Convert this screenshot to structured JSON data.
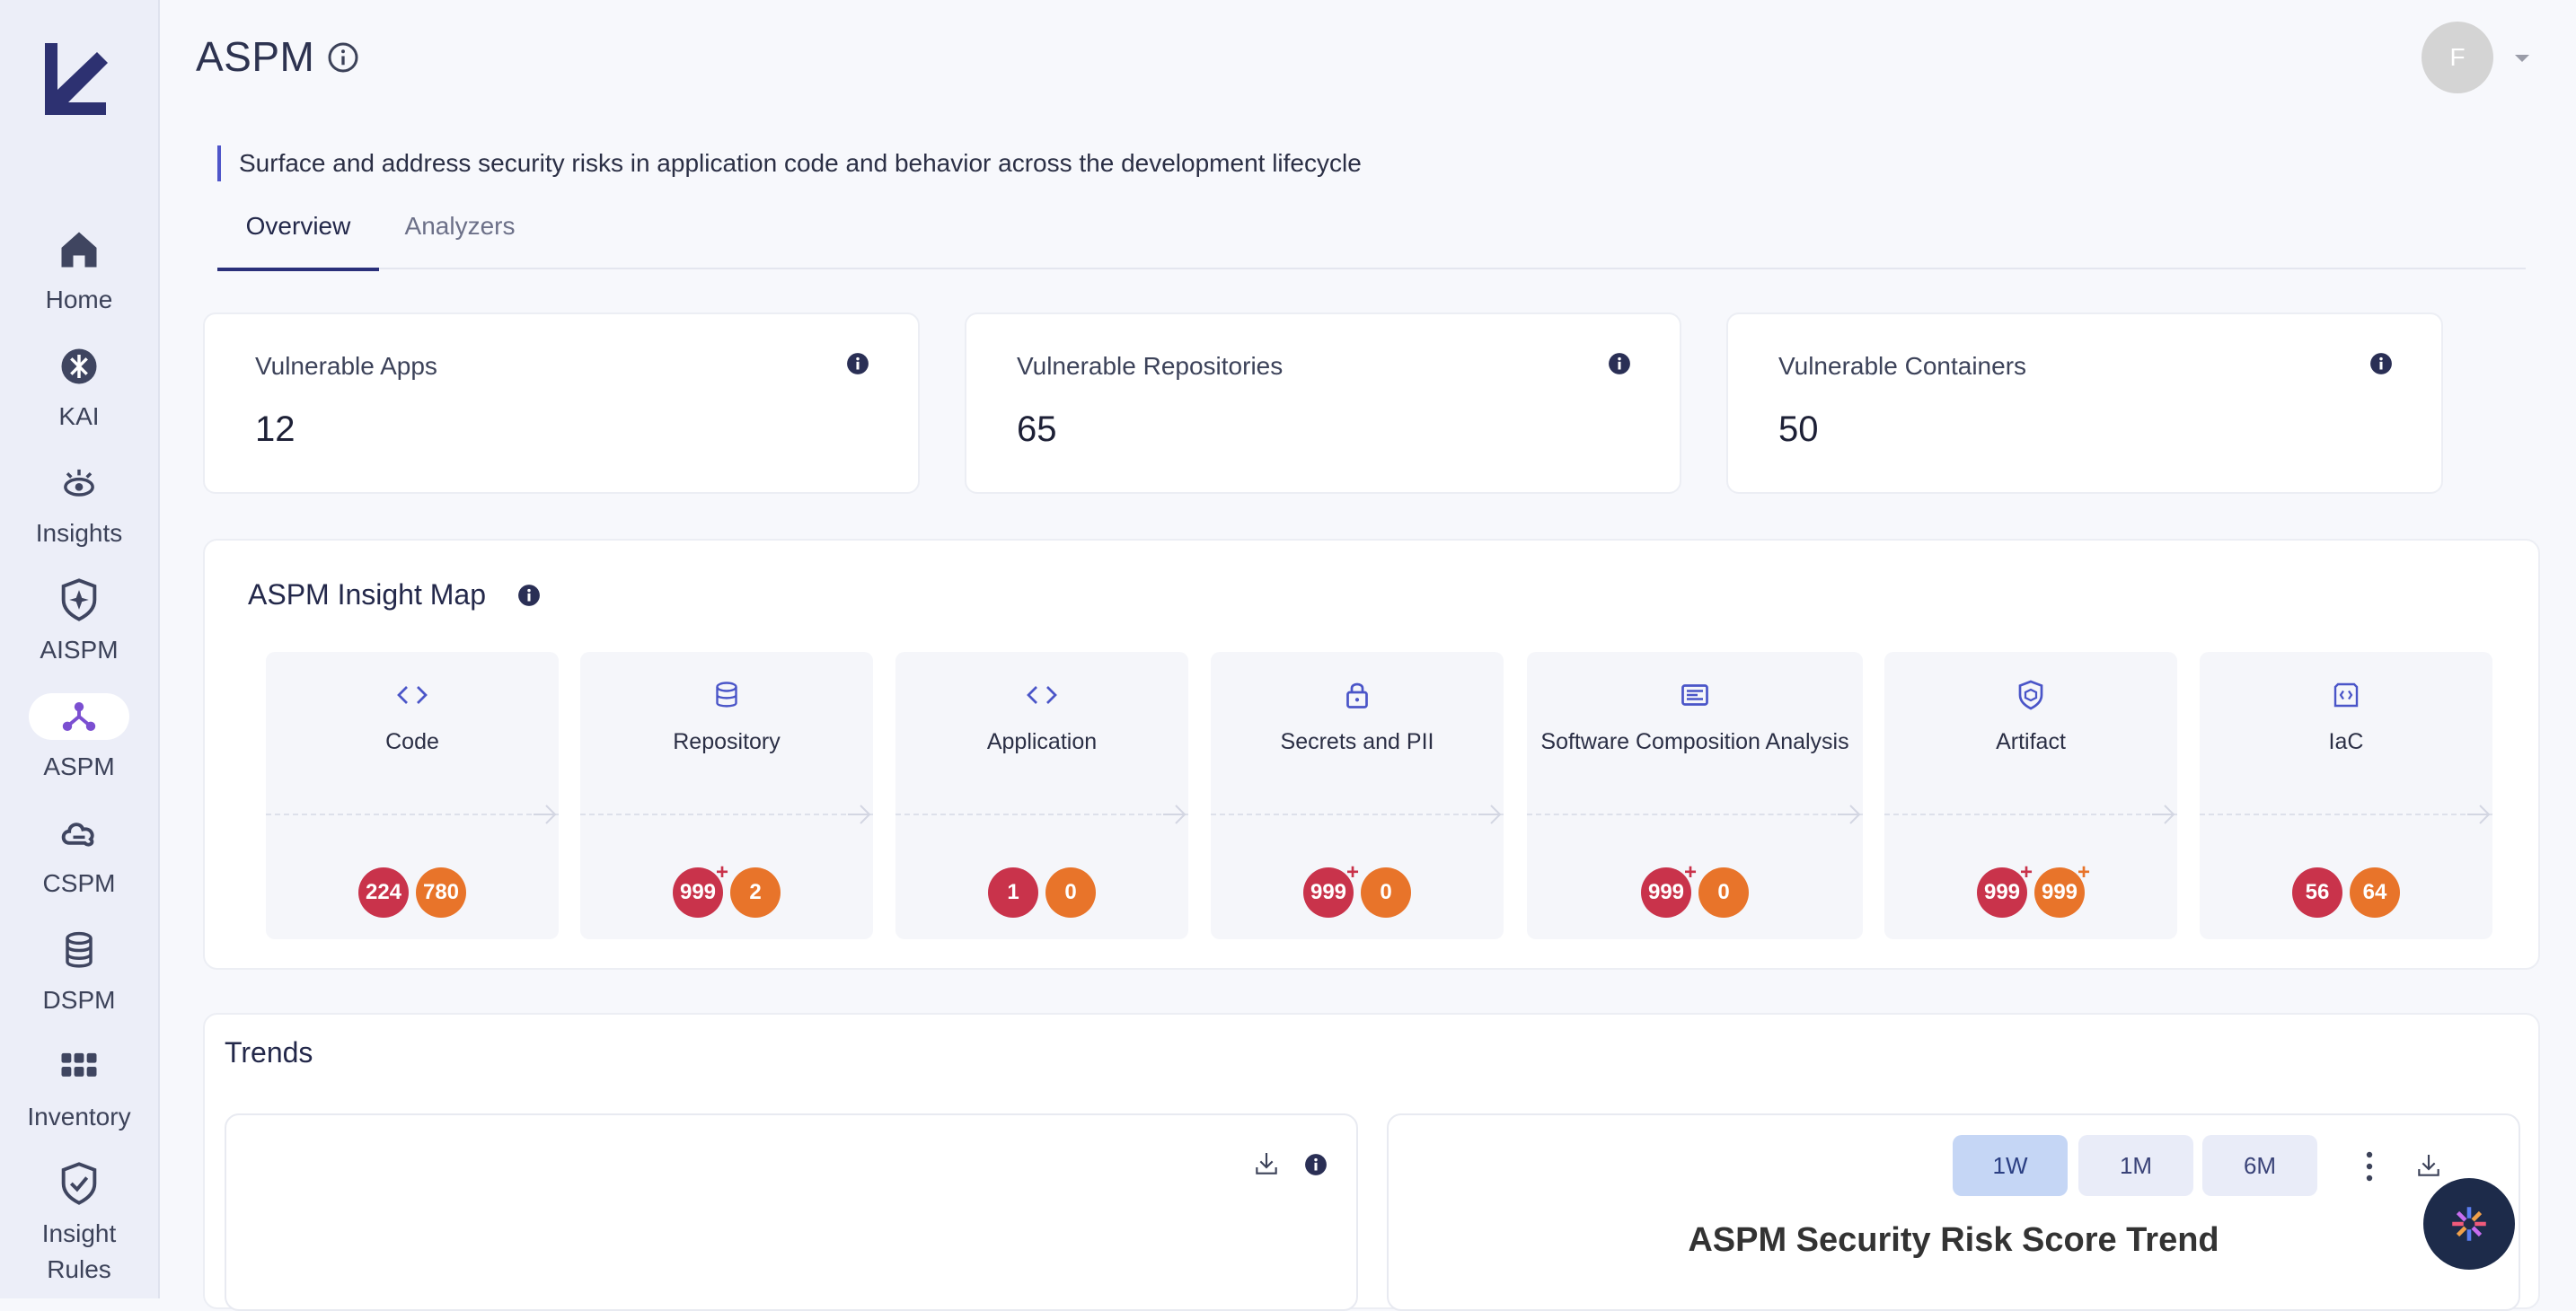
{
  "sidebar": {
    "items": [
      {
        "label": "Home",
        "icon": "home-icon"
      },
      {
        "label": "KAI",
        "icon": "kai-icon"
      },
      {
        "label": "Insights",
        "icon": "insights-icon"
      },
      {
        "label": "AISPM",
        "icon": "shield-star-icon"
      },
      {
        "label": "ASPM",
        "icon": "network-icon",
        "active": true
      },
      {
        "label": "CSPM",
        "icon": "cloud-icon"
      },
      {
        "label": "DSPM",
        "icon": "database-icon"
      },
      {
        "label": "Inventory",
        "icon": "grid-icon"
      },
      {
        "label": "Insight Rules",
        "icon": "shield-check-icon"
      }
    ]
  },
  "header": {
    "title": "ASPM",
    "avatar_initial": "F",
    "subtitle": "Surface and address security risks in application code and behavior across the development lifecycle"
  },
  "tabs": [
    {
      "label": "Overview",
      "active": true
    },
    {
      "label": "Analyzers",
      "active": false
    }
  ],
  "stats": [
    {
      "label": "Vulnerable Apps",
      "value": "12"
    },
    {
      "label": "Vulnerable Repositories",
      "value": "65"
    },
    {
      "label": "Vulnerable Containers",
      "value": "50"
    }
  ],
  "insight_map": {
    "title": "ASPM Insight Map",
    "stages": [
      {
        "label": "Code",
        "icon": "code-icon",
        "critical": "224",
        "high": "780"
      },
      {
        "label": "Repository",
        "icon": "database-icon",
        "critical": "999",
        "critical_plus": "+",
        "high": "2"
      },
      {
        "label": "Application",
        "icon": "code-icon",
        "critical": "1",
        "high": "0"
      },
      {
        "label": "Secrets and PII",
        "icon": "lock-icon",
        "critical": "999",
        "critical_plus": "+",
        "high": "0"
      },
      {
        "label": "Software Composition Analysis",
        "icon": "sca-icon",
        "critical": "999",
        "critical_plus": "+",
        "high": "0"
      },
      {
        "label": "Artifact",
        "icon": "artifact-shield-icon",
        "critical": "999",
        "critical_plus": "+",
        "high": "999",
        "high_plus": "+"
      },
      {
        "label": "IaC",
        "icon": "iac-icon",
        "critical": "56",
        "high": "64"
      }
    ]
  },
  "trends": {
    "title": "Trends",
    "ranges": [
      "1W",
      "1M",
      "6M"
    ],
    "active_range": "1W",
    "chart_title": "ASPM Security Risk Score Trend"
  },
  "colors": {
    "accent": "#2a307a",
    "critical": "#c9334b",
    "high": "#e8742a",
    "sidebar_bg": "#eceef8"
  }
}
